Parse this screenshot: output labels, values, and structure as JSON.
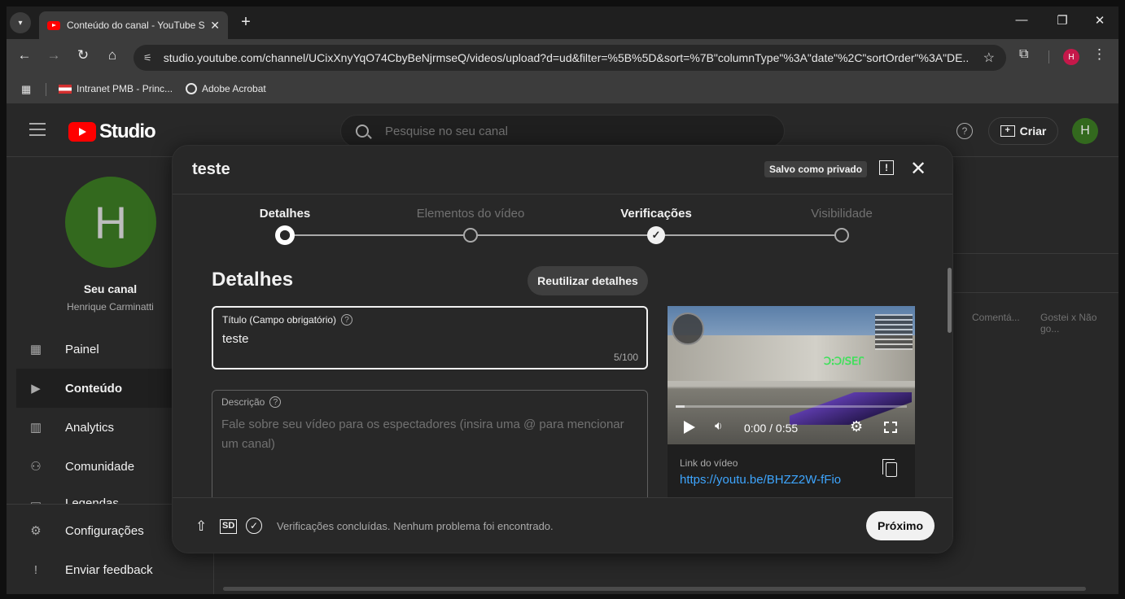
{
  "browser": {
    "tab_title": "Conteúdo do canal - YouTube S",
    "tab_close": "✕",
    "new_tab": "+",
    "url": "studio.youtube.com/channel/UCixXnyYqO74CbyBeNjrmseQ/videos/upload?d=ud&filter=%5B%5D&sort=%7B\"columnType\"%3A\"date\"%2C\"sortOrder\"%3A\"DE...",
    "profile_initial": "H",
    "bookmarks": [
      {
        "label": "Intranet PMB - Princ..."
      },
      {
        "label": "Adobe Acrobat"
      }
    ],
    "window_controls": {
      "minimize": "—",
      "restore": "❐",
      "close": "✕"
    }
  },
  "studio": {
    "logo_text": "Studio",
    "search_placeholder": "Pesquise no seu canal",
    "help": "?",
    "create_label": "Criar",
    "avatar_initial": "H"
  },
  "sidebar": {
    "avatar_initial": "H",
    "channel_name": "Seu canal",
    "channel_owner": "Henrique Carminatti",
    "items": [
      {
        "label": "Painel",
        "icon": "dashboard-icon",
        "glyph": "▦"
      },
      {
        "label": "Conteúdo",
        "icon": "content-icon",
        "glyph": "▶"
      },
      {
        "label": "Analytics",
        "icon": "analytics-icon",
        "glyph": "▥"
      },
      {
        "label": "Comunidade",
        "icon": "community-icon",
        "glyph": "⚇"
      },
      {
        "label": "Legendas",
        "icon": "subtitles-icon",
        "glyph": "▭"
      },
      {
        "label": "Configurações",
        "icon": "settings-icon",
        "glyph": "⚙"
      },
      {
        "label": "Enviar feedback",
        "icon": "feedback-icon",
        "glyph": "!"
      }
    ]
  },
  "table_columns": [
    "Comentá...",
    "Gostei x Não go..."
  ],
  "dialog": {
    "title": "teste",
    "saved_badge": "Salvo como privado",
    "feedback_glyph": "!",
    "close_glyph": "✕",
    "steps": [
      {
        "label": "Detalhes",
        "state": "current"
      },
      {
        "label": "Elementos do vídeo",
        "state": "pending"
      },
      {
        "label": "Verificações",
        "state": "done"
      },
      {
        "label": "Visibilidade",
        "state": "pending"
      }
    ],
    "section_title": "Detalhes",
    "reuse_button": "Reutilizar detalhes",
    "title_field": {
      "label": "Título (Campo obrigatório)",
      "value": "teste",
      "count": "5/100"
    },
    "description_field": {
      "label": "Descrição",
      "placeholder": "Fale sobre seu vídeo para os espectadores (insira uma @ para mencionar um canal)"
    },
    "preview": {
      "time": "0:00 / 0:55",
      "progress": 0.04,
      "link_label": "Link do vídeo",
      "link_url": "https://youtu.be/BHZZ2W-fFio"
    },
    "footer": {
      "status": "Verificações concluídas. Nenhum problema foi encontrado.",
      "sd_label": "SD",
      "next_button": "Próximo"
    }
  }
}
